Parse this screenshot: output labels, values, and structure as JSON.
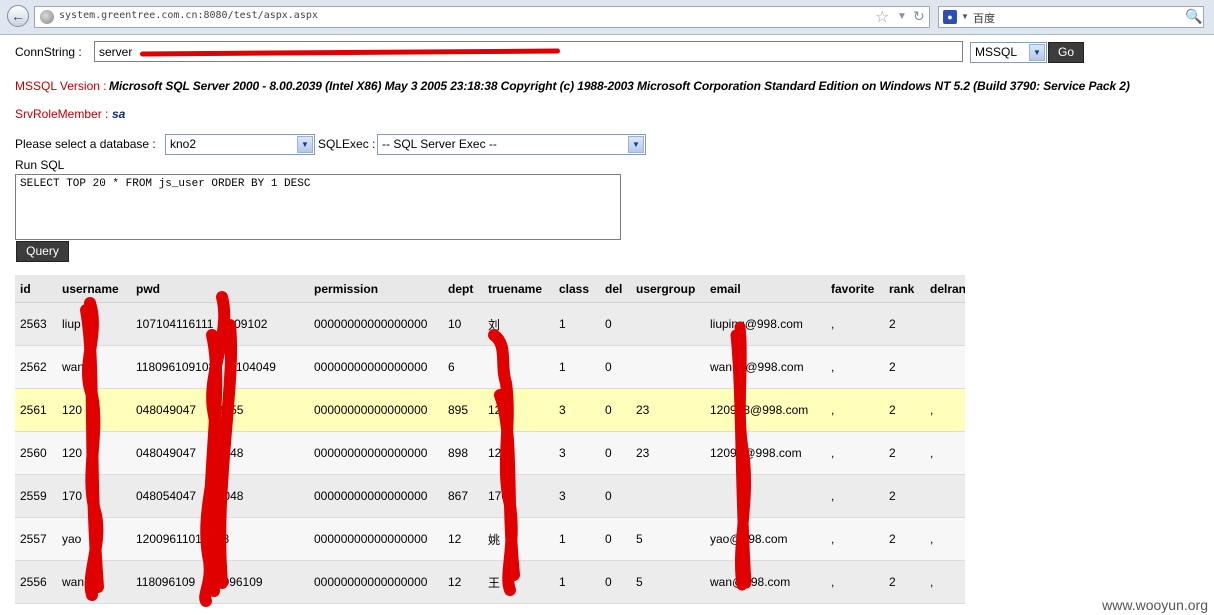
{
  "browser": {
    "url": "system.greentree.com.cn:8080/test/aspx.aspx",
    "search_engine": "百度"
  },
  "conn": {
    "label": "ConnString :",
    "value": "server",
    "db_type": "MSSQL",
    "go_label": "Go"
  },
  "server": {
    "version_label": "MSSQL Version :",
    "version_value": "Microsoft SQL Server 2000 - 8.00.2039 (Intel X86) May 3 2005 23:18:38 Copyright (c) 1988-2003 Microsoft Corporation Standard Edition on Windows NT 5.2 (Build 3790: Service Pack 2)",
    "role_label": "SrvRoleMember :",
    "role_value": "sa"
  },
  "db": {
    "select_label": "Please select a database :",
    "selected": "kno2",
    "exec_label": "SQLExec :",
    "exec_selected": "-- SQL Server Exec --"
  },
  "sql": {
    "label": "Run SQL",
    "query": "SELECT TOP 20 * FROM js_user ORDER BY 1 DESC",
    "query_button": "Query"
  },
  "table": {
    "columns": [
      "id",
      "username",
      "pwd",
      "permission",
      "dept",
      "truename",
      "class",
      "del",
      "usergroup",
      "email",
      "favorite",
      "rank",
      "delran"
    ],
    "rows": [
      [
        "2563",
        "liup",
        "107104116111",
        "109102",
        "00000000000000000",
        "10",
        "刘",
        "1",
        "0",
        "",
        "liuping@998.com",
        ",",
        "2",
        ""
      ],
      [
        "2562",
        "wan",
        "118096109108",
        "7104049",
        "00000000000000000",
        "6",
        "",
        "1",
        "0",
        "",
        "wan12@998.com",
        ",",
        "2",
        ""
      ],
      [
        "2561",
        "120",
        "048049047",
        "49055",
        "00000000000000000",
        "895",
        "120",
        "3",
        "0",
        "23",
        "120928@998.com",
        ",",
        "2",
        ","
      ],
      [
        "2560",
        "120",
        "048049047",
        "53048",
        "00000000000000000",
        "898",
        "120",
        "3",
        "0",
        "23",
        "12091@998.com",
        ",",
        "2",
        ","
      ],
      [
        "2559",
        "170",
        "048054047",
        "56048",
        "00000000000000000",
        "867",
        "170",
        "3",
        "0",
        "",
        "",
        ",",
        "2",
        ""
      ],
      [
        "2557",
        "yao",
        "1200961101",
        "18",
        "00000000000000000",
        "12",
        "姚",
        "1",
        "0",
        "5",
        "yao@998.com",
        ",",
        "2",
        ","
      ],
      [
        "2556",
        "wan",
        "118096109",
        "07096109",
        "00000000000000000",
        "12",
        "王",
        "1",
        "0",
        "5",
        "wan@998.com",
        ",",
        "2",
        ","
      ]
    ]
  },
  "watermark": "www.wooyun.org",
  "colors": {
    "label_red": "#c00000",
    "highlight_row": "#ffffbb",
    "redaction": "#e00000"
  }
}
